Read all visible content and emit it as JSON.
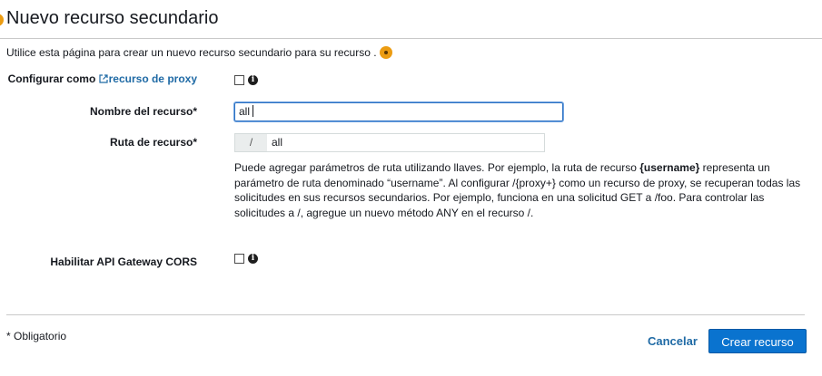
{
  "header": {
    "title": "Nuevo recurso secundario"
  },
  "intro": {
    "text": "Utilice esta página para crear un nuevo recurso secundario para su recurso ."
  },
  "form": {
    "proxy": {
      "label_prefix": "Configurar como",
      "label_link": "recurso de proxy",
      "checked": false
    },
    "resource_name": {
      "label": "Nombre del recurso*",
      "value": "all"
    },
    "resource_path": {
      "label": "Ruta de recurso*",
      "prefix": "/",
      "value": "all",
      "help_part1": "Puede agregar parámetros de ruta utilizando llaves. Por ejemplo, la ruta de recurso ",
      "help_bold": "{username}",
      "help_part2": " representa un parámetro de ruta denominado “username”. Al configurar /{proxy+} como un recurso de proxy, se recuperan todas las solicitudes en sus recursos secundarios. Por ejemplo, funciona en una solicitud GET a /foo. Para controlar las solicitudes a /, agregue un nuevo método ANY en el recurso /."
    },
    "cors": {
      "label": "Habilitar API Gateway CORS",
      "checked": false
    }
  },
  "footer": {
    "required_note": "* Obligatorio",
    "cancel_label": "Cancelar",
    "create_label": "Crear recurso"
  },
  "icons": {
    "info": "info-icon",
    "external_link": "external-link-icon"
  },
  "colors": {
    "accent_orange": "#ec9c12",
    "link_blue": "#1f6aa5",
    "primary_button": "#0a73cf"
  }
}
